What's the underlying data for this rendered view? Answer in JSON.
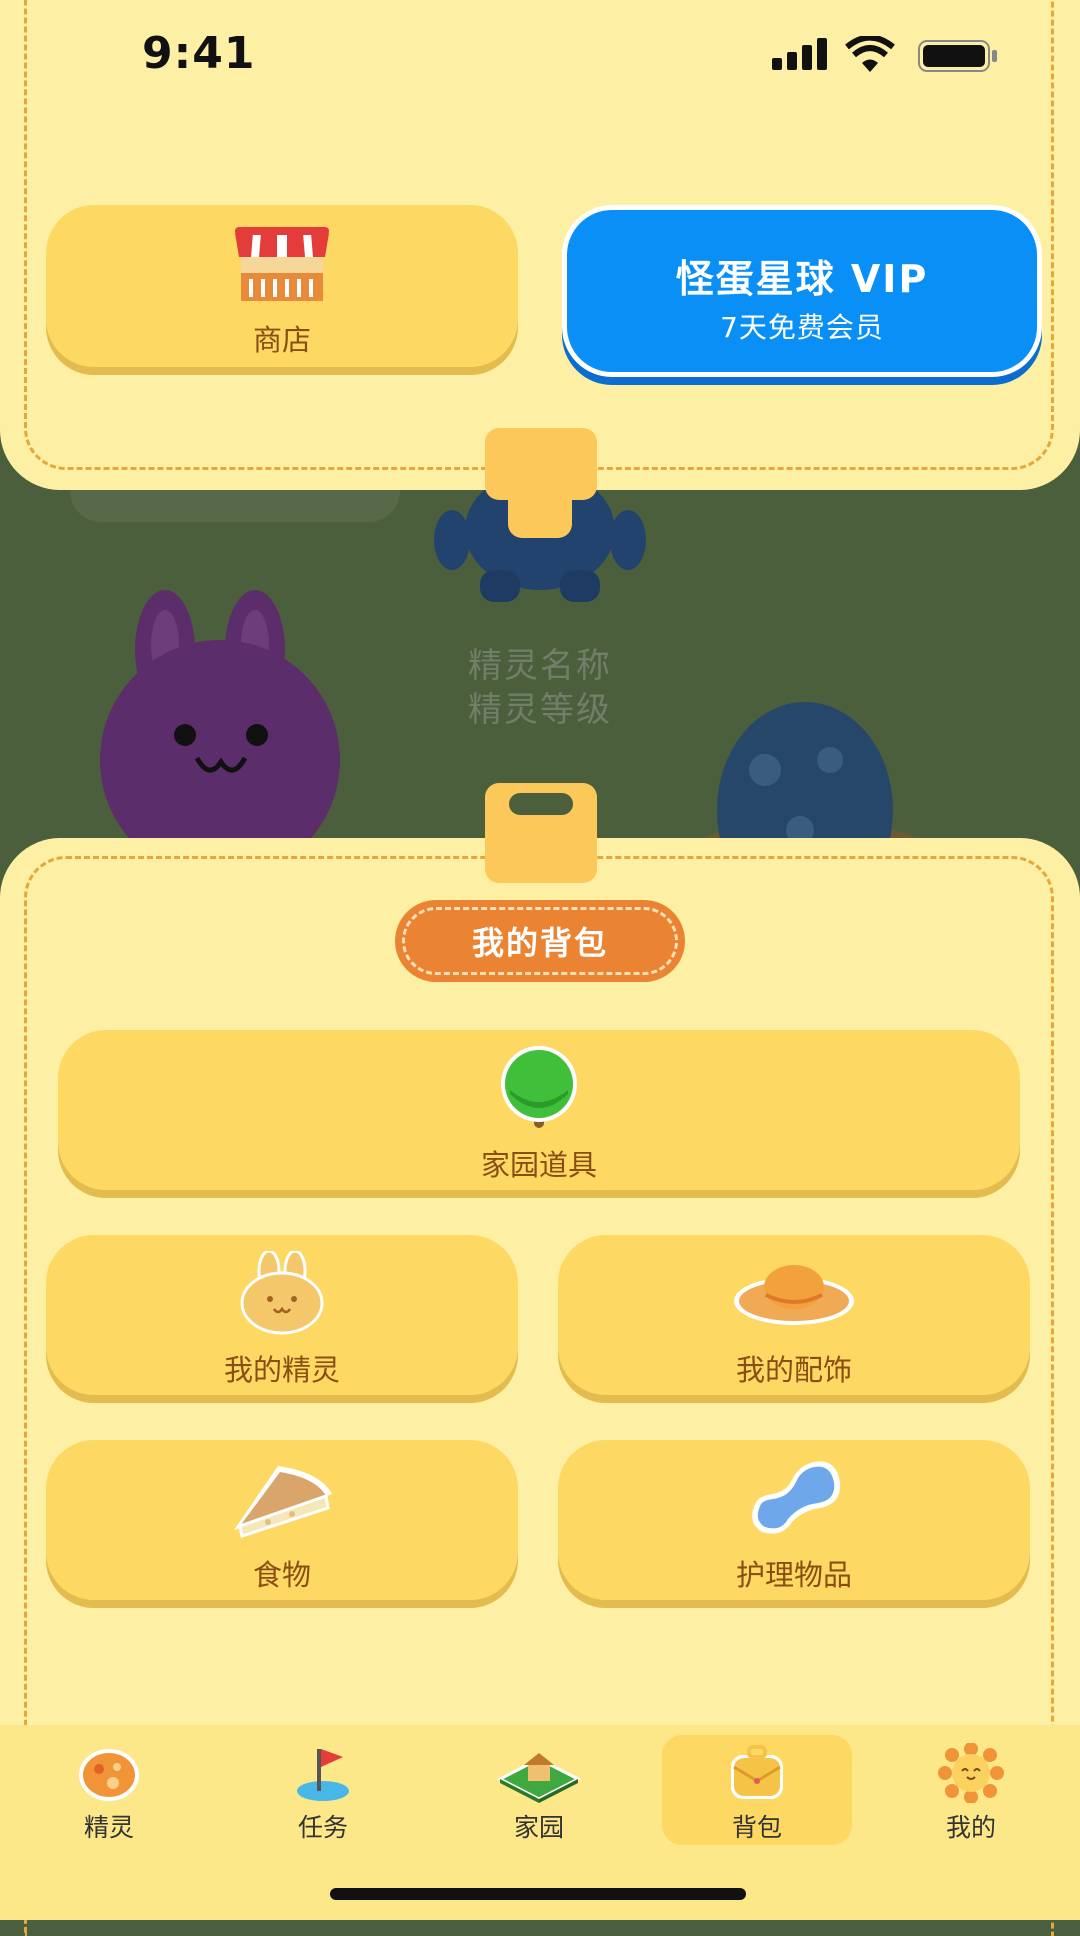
{
  "status_bar": {
    "time": "9:41"
  },
  "top": {
    "shop_label": "商店",
    "vip_title": "怪蛋星球 VIP",
    "vip_subtitle": "7天免费会员"
  },
  "scene": {
    "sprite_name": "精灵名称",
    "sprite_level": "精灵等级"
  },
  "backpack": {
    "title": "我的背包",
    "items": [
      {
        "label": "家园道具",
        "icon": "tree-icon"
      },
      {
        "label": "我的精灵",
        "icon": "bunny-icon"
      },
      {
        "label": "我的配饰",
        "icon": "hat-icon"
      },
      {
        "label": "食物",
        "icon": "cheese-icon"
      },
      {
        "label": "护理物品",
        "icon": "bone-icon"
      }
    ]
  },
  "nav": {
    "items": [
      {
        "label": "精灵",
        "icon": "egg-icon"
      },
      {
        "label": "任务",
        "icon": "flag-icon"
      },
      {
        "label": "家园",
        "icon": "house-icon"
      },
      {
        "label": "背包",
        "icon": "backpack-icon"
      },
      {
        "label": "我的",
        "icon": "sun-icon"
      }
    ],
    "active": "背包"
  },
  "colors": {
    "panel": "#fdf0a4",
    "card": "#fdd964",
    "vip": "#0a8ff7",
    "title_pill": "#ea8432",
    "scene": "#4b5f3c"
  }
}
